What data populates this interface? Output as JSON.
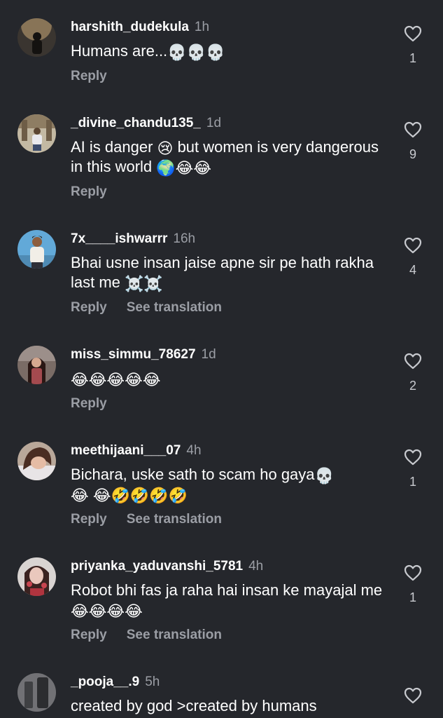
{
  "comments": [
    {
      "username": "harshith_dudekula",
      "time": "1h",
      "text": "Humans are...",
      "emojis": "💀💀💀",
      "reply_label": "Reply",
      "likes": "1"
    },
    {
      "username": "_divine_chandu135_",
      "time": "1d",
      "text_a": "AI is danger ",
      "emoji_a": "😢",
      "text_b": " but women is very dangerous in this world ",
      "emojis": "🌍😂😂",
      "reply_label": "Reply",
      "likes": "9"
    },
    {
      "username": "7x____ishwarrr",
      "time": "16h",
      "text": "Bhai usne insan jaise apne sir pe hath rakha last me ",
      "emojis": "☠️☠️",
      "reply_label": "Reply",
      "translate_label": "See translation",
      "likes": "4"
    },
    {
      "username": "miss_simmu_78627",
      "time": "1d",
      "emojis": "😂😂😂😂😂",
      "reply_label": "Reply",
      "likes": "2"
    },
    {
      "username": "meethijaani___07",
      "time": "4h",
      "text": "Bichara, uske sath to scam ho gaya",
      "emoji_a": "💀",
      "emojis": " 😂 😂🤣🤣🤣🤣",
      "reply_label": "Reply",
      "translate_label": "See translation",
      "likes": "1"
    },
    {
      "username": "priyanka_yaduvanshi_5781",
      "time": "4h",
      "text": "Robot bhi fas ja raha hai insan ke mayajal me",
      "emojis": "😂😂😂😂",
      "reply_label": "Reply",
      "translate_label": "See translation",
      "likes": "1"
    },
    {
      "username": "_pooja__.9",
      "time": "5h",
      "text": "created by god >created by humans",
      "likes": ""
    }
  ]
}
